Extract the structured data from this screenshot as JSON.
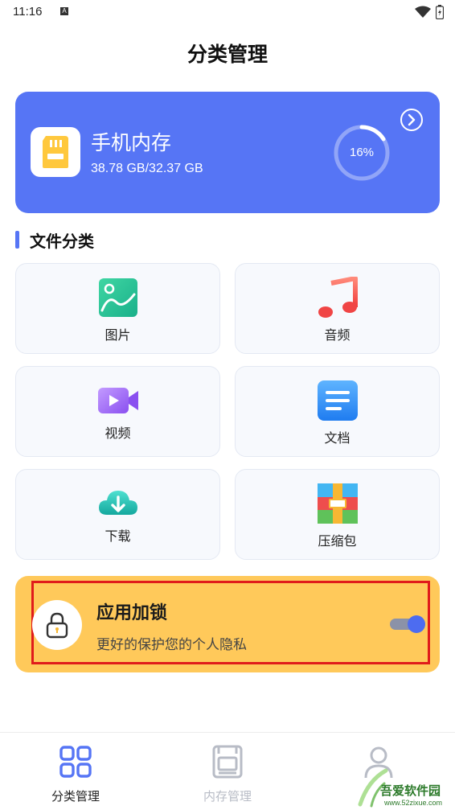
{
  "status_bar": {
    "time": "11:16",
    "notification_letter": "A"
  },
  "page": {
    "title": "分类管理"
  },
  "storage": {
    "title": "手机内存",
    "size": "38.78 GB/32.37 GB",
    "percent_label": "16%",
    "percent_value": 0.16
  },
  "section": {
    "title": "文件分类"
  },
  "categories": [
    {
      "label": "图片",
      "icon": "image-icon"
    },
    {
      "label": "音频",
      "icon": "music-icon"
    },
    {
      "label": "视频",
      "icon": "video-icon"
    },
    {
      "label": "文档",
      "icon": "document-icon"
    },
    {
      "label": "下载",
      "icon": "cloud-download-icon"
    },
    {
      "label": "压缩包",
      "icon": "archive-icon"
    }
  ],
  "app_lock": {
    "title": "应用加锁",
    "subtitle": "更好的保护您的个人隐私",
    "enabled": true
  },
  "bottom_nav": [
    {
      "label": "分类管理",
      "icon": "grid-icon",
      "active": true
    },
    {
      "label": "内存管理",
      "icon": "storage-icon",
      "active": false
    },
    {
      "label": "",
      "icon": "person-icon",
      "active": false
    }
  ],
  "watermark": {
    "text": "吾爱软件园",
    "url": "www.52zixue.com"
  },
  "colors": {
    "accent": "#5675f5",
    "lock_bg": "#ffc95a",
    "highlight": "#e01b1b",
    "nav_inactive": "#b8bcc6"
  }
}
